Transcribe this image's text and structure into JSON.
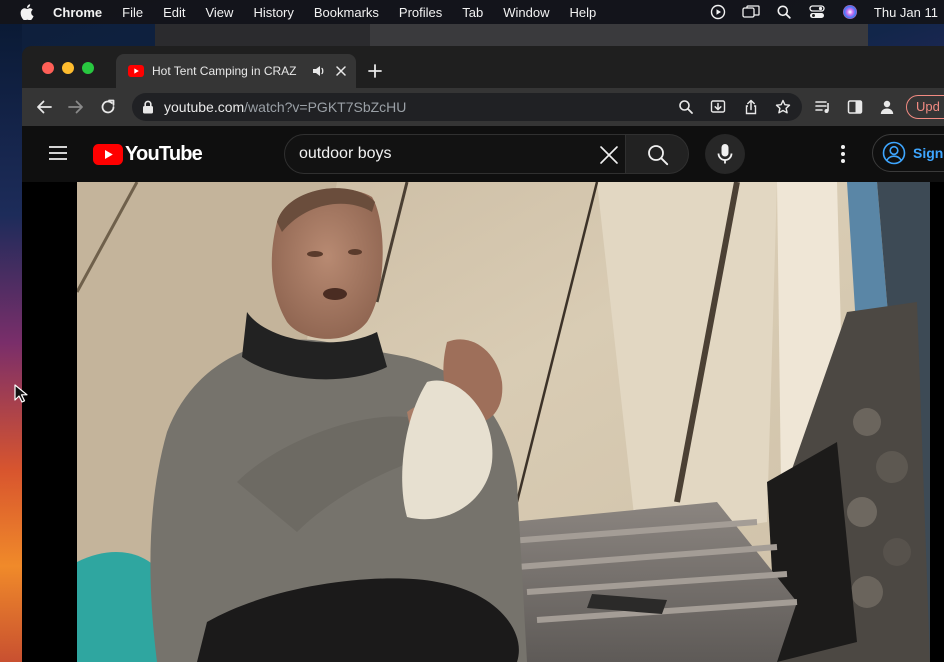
{
  "menubar": {
    "app": "Chrome",
    "items": [
      "File",
      "Edit",
      "View",
      "History",
      "Bookmarks",
      "Profiles",
      "Tab",
      "Window",
      "Help"
    ],
    "clock": "Thu Jan 11"
  },
  "browser": {
    "tab_title": "Hot Tent Camping in CRAZ",
    "url_host": "youtube.com",
    "url_path": "/watch?v=PGKT7SbZcHU",
    "update_label": "Upd"
  },
  "youtube": {
    "logo_text": "YouTube",
    "search_value": "outdoor boys",
    "sign_in_label": "Sign in"
  },
  "colors": {
    "youtube_red": "#ff0000",
    "link_blue": "#3ea6ff",
    "update_red": "#f28b82"
  }
}
